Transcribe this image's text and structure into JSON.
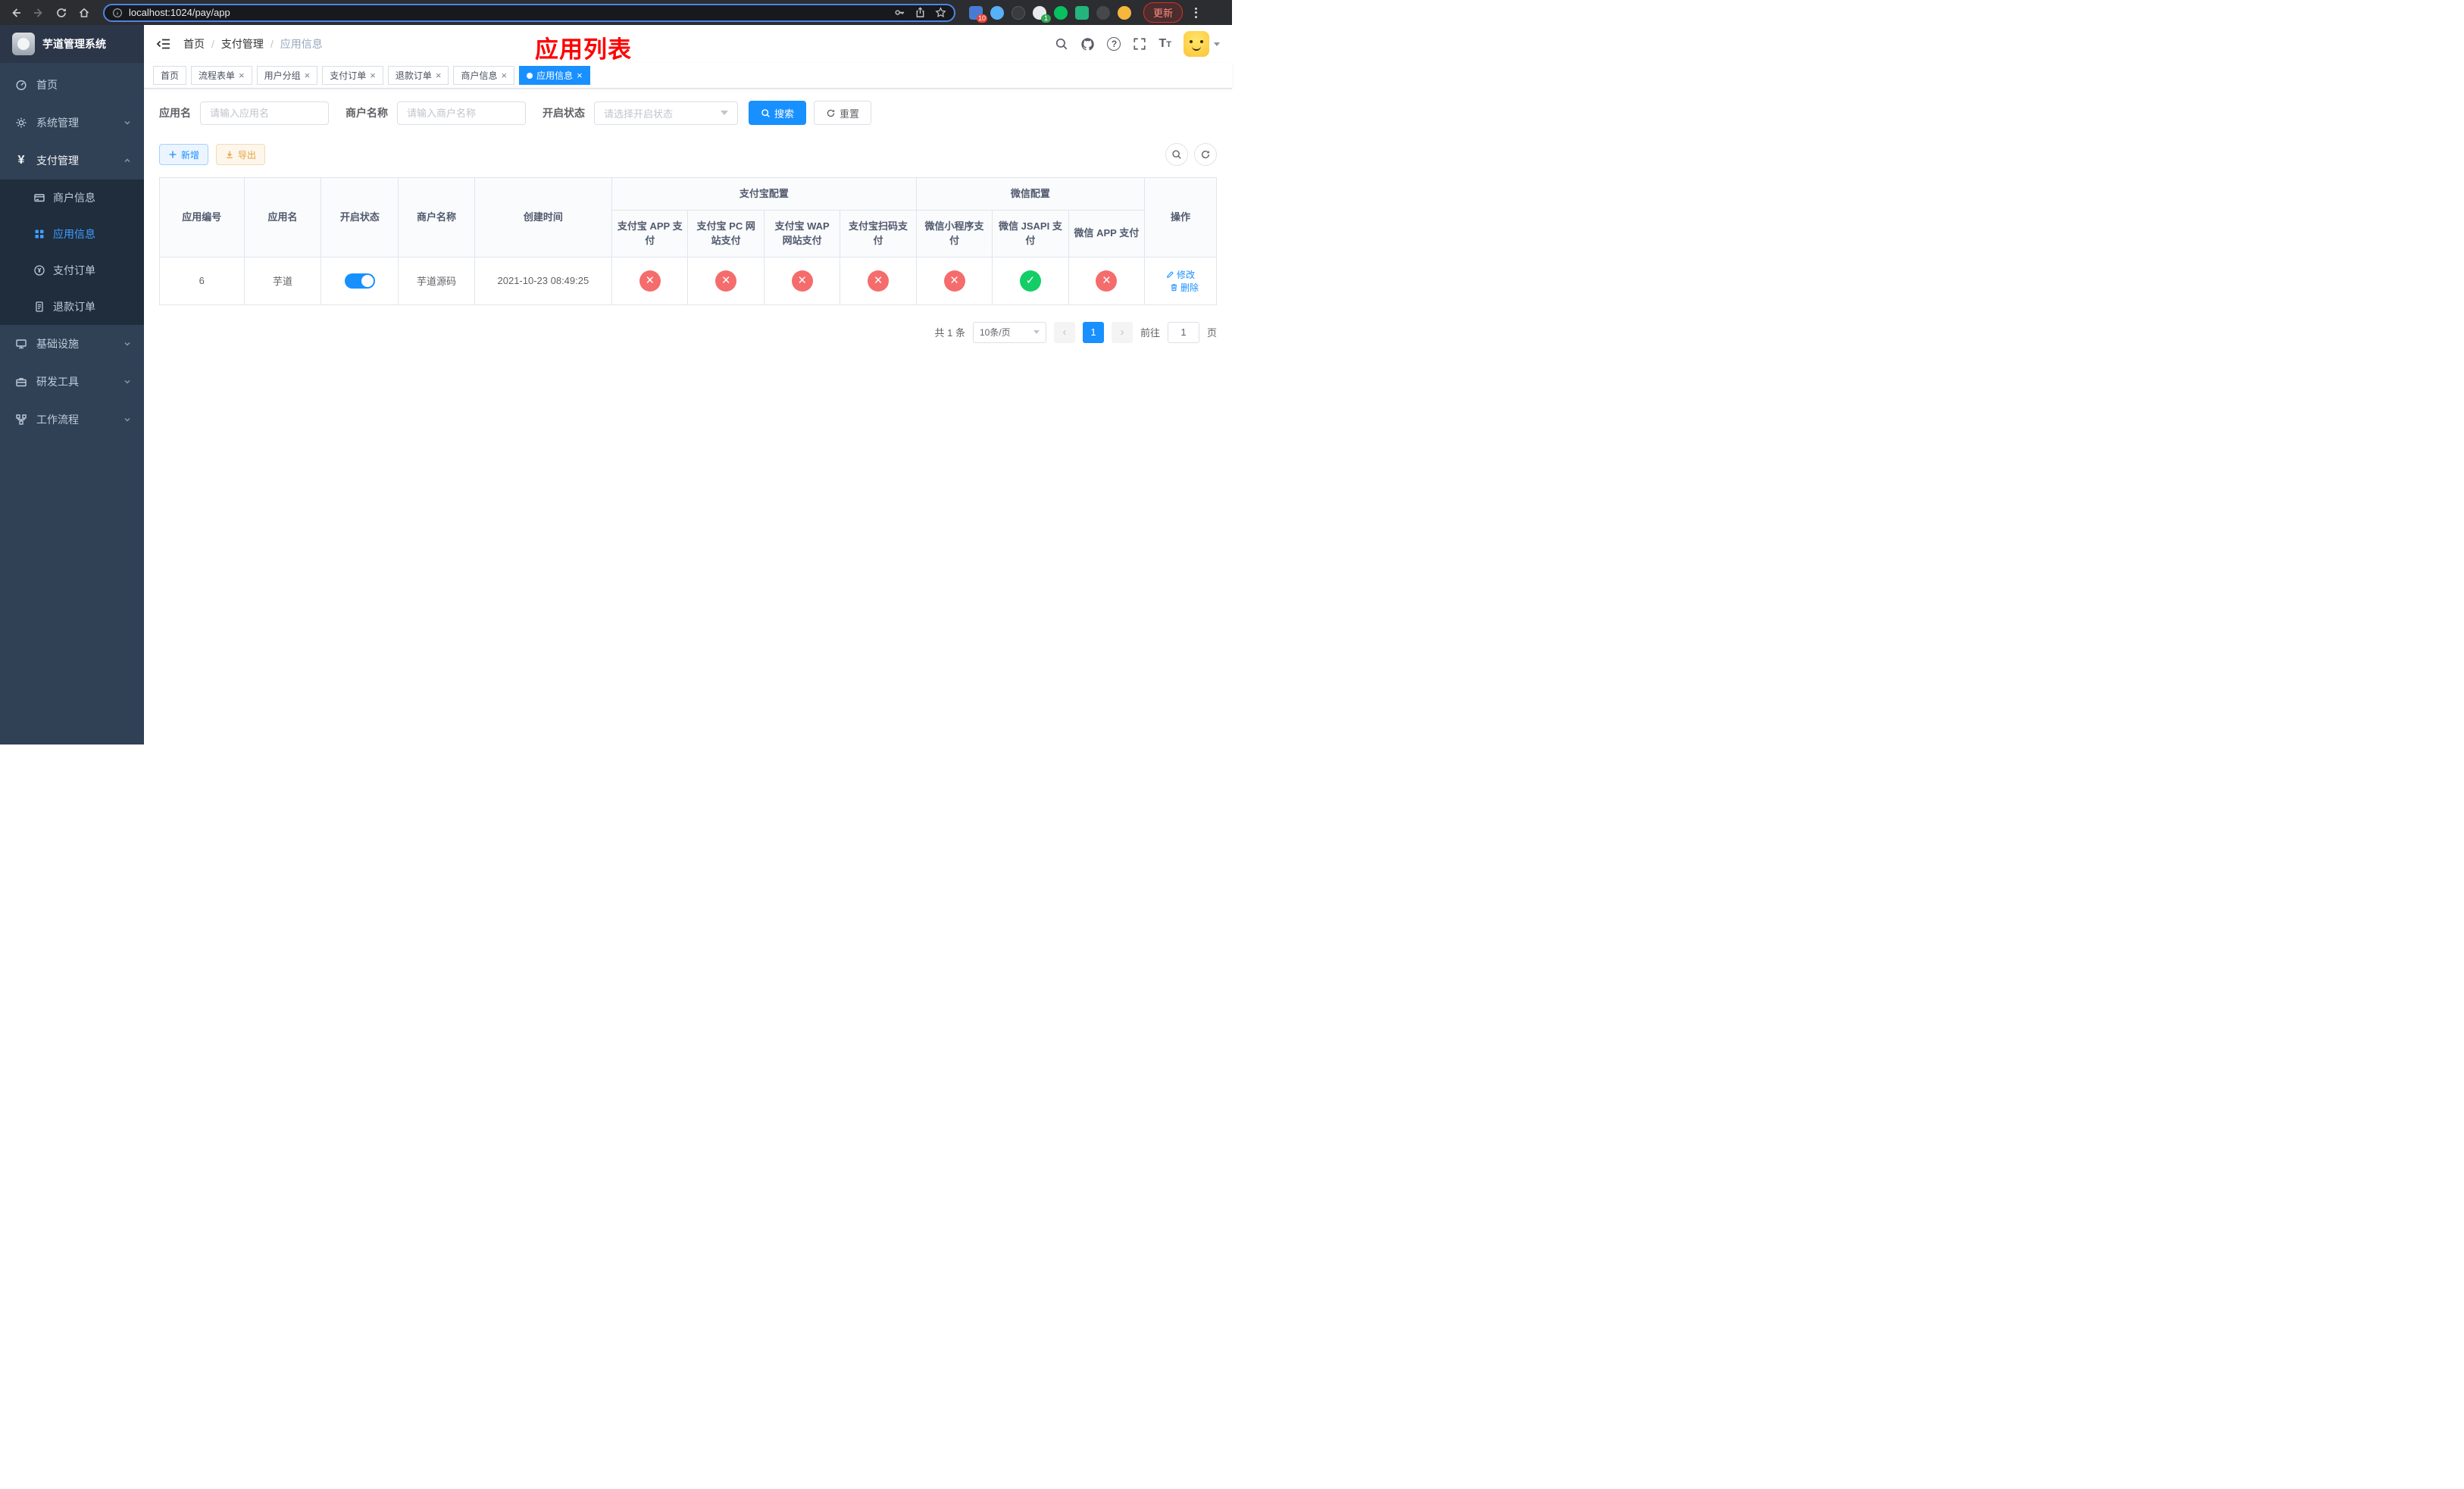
{
  "colors": {
    "accent": "#1890ff",
    "danger": "#f56c6c",
    "success": "#13ce66",
    "sidebar_bg": "#304156",
    "title_red": "#ff0000"
  },
  "browser": {
    "url_host": "localhost:1024",
    "url_path": "/pay/app",
    "update_label": "更新",
    "ext_badge_a": "10",
    "ext_badge_b": "1"
  },
  "sidebar": {
    "title": "芋道管理系统",
    "home": "首页",
    "system": "系统管理",
    "payment": "支付管理",
    "children": {
      "merchant": "商户信息",
      "app": "应用信息",
      "order": "支付订单",
      "refund": "退款订单"
    },
    "infra": "基础设施",
    "devtools": "研发工具",
    "workflow": "工作流程"
  },
  "header": {
    "breadcrumb": {
      "home": "首页",
      "section": "支付管理",
      "current": "应用信息"
    },
    "page_title": "应用列表"
  },
  "tabs": [
    {
      "label": "首页",
      "closable": false,
      "active": false
    },
    {
      "label": "流程表单",
      "closable": true,
      "active": false
    },
    {
      "label": "用户分组",
      "closable": true,
      "active": false
    },
    {
      "label": "支付订单",
      "closable": true,
      "active": false
    },
    {
      "label": "退款订单",
      "closable": true,
      "active": false
    },
    {
      "label": "商户信息",
      "closable": true,
      "active": false
    },
    {
      "label": "应用信息",
      "closable": true,
      "active": true
    }
  ],
  "filters": {
    "app_name_label": "应用名",
    "app_name_placeholder": "请输入应用名",
    "merchant_label": "商户名称",
    "merchant_placeholder": "请输入商户名称",
    "status_label": "开启状态",
    "status_placeholder": "请选择开启状态",
    "search_label": "搜索",
    "reset_label": "重置"
  },
  "toolbar": {
    "add_label": "新增",
    "export_label": "导出"
  },
  "table": {
    "groups": {
      "alipay": "支付宝配置",
      "wechat": "微信配置"
    },
    "columns": [
      "应用编号",
      "应用名",
      "开启状态",
      "商户名称",
      "创建时间",
      "支付宝 APP 支付",
      "支付宝 PC 网站支付",
      "支付宝 WAP 网站支付",
      "支付宝扫码支付",
      "微信小程序支付",
      "微信 JSAPI 支付",
      "微信 APP 支付",
      "操作"
    ],
    "rows": [
      {
        "id": "6",
        "name": "芋道",
        "status": "on",
        "merchant": "芋道源码",
        "created_at": "2021-10-23 08:49:25",
        "configs": [
          "no",
          "no",
          "no",
          "no",
          "no",
          "yes",
          "no"
        ],
        "edit": "修改",
        "delete": "删除"
      }
    ]
  },
  "pagination": {
    "total": "共 1 条",
    "size": "10条/页",
    "page": "1",
    "go_prefix": "前往",
    "go_value": "1",
    "go_suffix": "页"
  }
}
